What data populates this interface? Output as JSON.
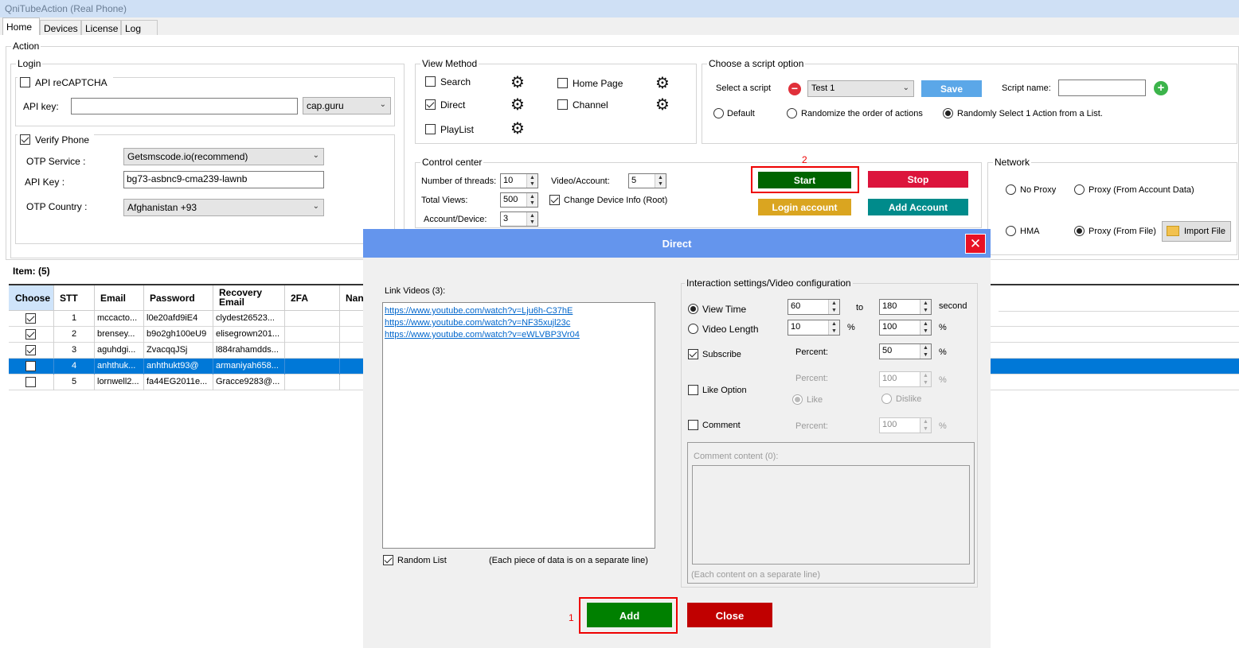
{
  "app": {
    "title": "QniTubeAction (Real Phone)"
  },
  "tabs": [
    "Home",
    "Devices",
    "License",
    "Log"
  ],
  "action": {
    "legend": "Action",
    "login": {
      "legend": "Login",
      "api_recaptcha": "API reCAPTCHA",
      "api_key_label": "API key:",
      "api_key_value": "",
      "captcha_service": "cap.guru",
      "verify_phone": "Verify Phone",
      "otp_service_label": "OTP Service :",
      "otp_service_value": "Getsmscode.io(recommend)",
      "api_key2_label": "API Key :",
      "api_key2_value": "bg73-asbnc9-cma239-lawnb",
      "otp_country_label": "OTP Country :",
      "otp_country_value": "Afghanistan +93"
    },
    "view_method": {
      "legend": "View Method",
      "search": "Search",
      "direct": "Direct",
      "playlist": "PlayList",
      "home_page": "Home Page",
      "channel": "Channel"
    },
    "script_option": {
      "legend": "Choose a script option",
      "select_label": "Select a script",
      "select_value": "Test 1",
      "save": "Save",
      "script_name_label": "Script name:",
      "script_name_value": "",
      "default": "Default",
      "randomize": "Randomize the order of actions",
      "random_select": "Randomly Select 1 Action from a List."
    },
    "control": {
      "legend": "Control center",
      "threads_label": "Number of threads:",
      "threads": "10",
      "video_account_label": "Video/Account:",
      "video_account": "5",
      "total_views_label": "Total Views:",
      "total_views": "500",
      "change_device": "Change Device Info (Root)",
      "account_device_label": "Account/Device:",
      "account_device": "3",
      "start": "Start",
      "stop": "Stop",
      "login_account": "Login account",
      "add_account": "Add Account",
      "annotation": "2"
    },
    "network": {
      "legend": "Network",
      "no_proxy": "No Proxy",
      "proxy_account": "Proxy (From Account Data)",
      "hma": "HMA",
      "proxy_file": "Proxy (From File)",
      "import_file": "Import File"
    }
  },
  "items": {
    "label": "Item: (5)",
    "headers": [
      "Choose",
      "STT",
      "Email",
      "Password",
      "Recovery Email",
      "2FA",
      "Nan"
    ],
    "rows": [
      {
        "stt": "1",
        "email": "mccacto...",
        "password": "l0e20afd9iE4",
        "recovery": "clydest26523..."
      },
      {
        "stt": "2",
        "email": "brensey...",
        "password": "b9o2gh100eU9",
        "recovery": "elisegrown201..."
      },
      {
        "stt": "3",
        "email": "aguhdgi...",
        "password": "ZvacqqJSj",
        "recovery": "l884rahamdds..."
      },
      {
        "stt": "4",
        "email": "anhthuk...",
        "password": "anhthukt93@",
        "recovery": "armaniyah658..."
      },
      {
        "stt": "5",
        "email": "lornwell2...",
        "password": "fa44EG2011e...",
        "recovery": "Gracce9283@..."
      }
    ]
  },
  "dialog": {
    "title": "Direct",
    "link_videos_label": "Link Videos (3):",
    "links": [
      "https://www.youtube.com/watch?v=Lju6h-C37hE",
      "https://www.youtube.com/watch?v=NF35xujl23c",
      "https://www.youtube.com/watch?v=eWLVBP3Vr04"
    ],
    "random_list": "Random List",
    "each_line_note": "(Each piece of data is on a separate line)",
    "interaction_legend": "Interaction settings/Video configuration",
    "view_time": "View Time",
    "view_time_from": "60",
    "to": "to",
    "view_time_to": "180",
    "second": "second",
    "video_length": "Video Length",
    "video_length_from": "10",
    "percent_sign": "%",
    "video_length_to": "100",
    "subscribe": "Subscribe",
    "percent_label": "Percent:",
    "subscribe_percent": "50",
    "like_percent": "100",
    "like_option": "Like Option",
    "like": "Like",
    "dislike": "Dislike",
    "comment": "Comment",
    "comment_percent": "100",
    "comment_content_label": "Comment content (0):",
    "comment_note": "(Each content on a separate line)",
    "add": "Add",
    "close": "Close",
    "annotation": "1"
  }
}
